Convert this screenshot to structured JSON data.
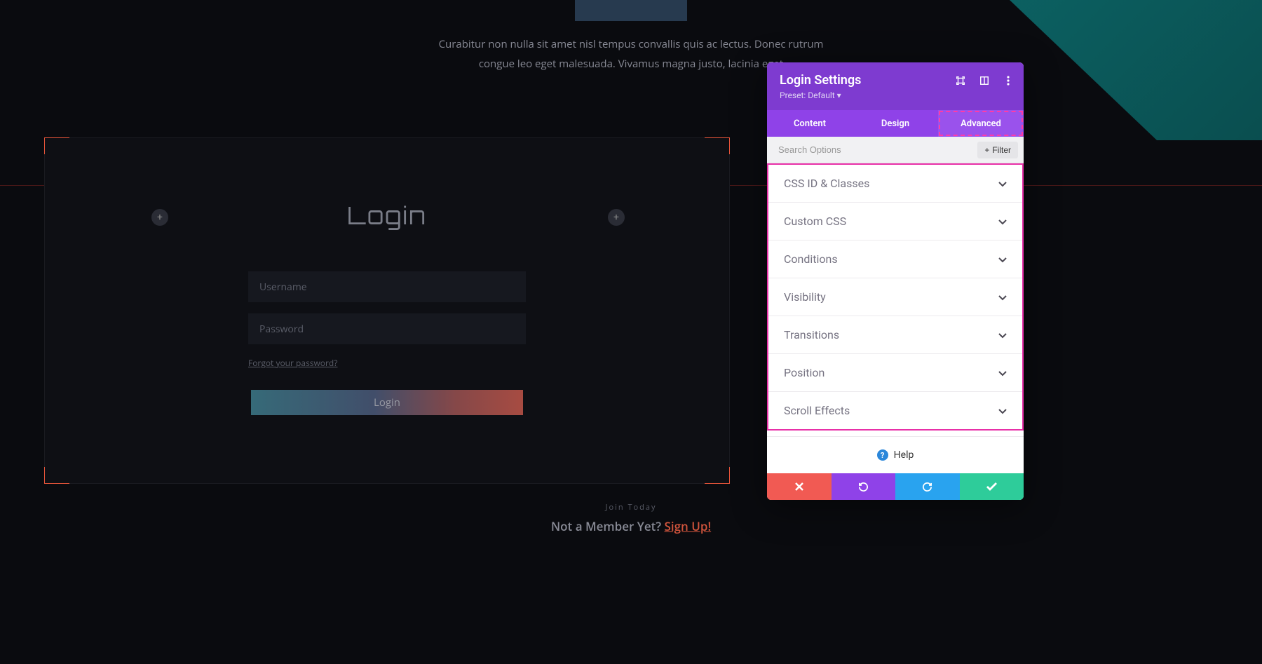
{
  "intro_text": "Curabitur non nulla sit amet nisl tempus convallis quis ac lectus. Donec rutrum congue leo eget malesuada. Vivamus magna justo, lacinia eget",
  "login": {
    "title": "Login",
    "username_placeholder": "Username",
    "password_placeholder": "Password",
    "forgot": "Forgot your password?",
    "button": "Login"
  },
  "lower": {
    "join": "Join Today",
    "prefix": "Not a Member Yet? ",
    "signup": "Sign Up!"
  },
  "panel": {
    "title": "Login Settings",
    "preset_label": "Preset: ",
    "preset_value": "Default",
    "tabs": {
      "content": "Content",
      "design": "Design",
      "advanced": "Advanced"
    },
    "search_placeholder": "Search Options",
    "filter_label": "Filter",
    "options": [
      "CSS ID & Classes",
      "Custom CSS",
      "Conditions",
      "Visibility",
      "Transitions",
      "Position",
      "Scroll Effects"
    ],
    "help": "Help"
  }
}
